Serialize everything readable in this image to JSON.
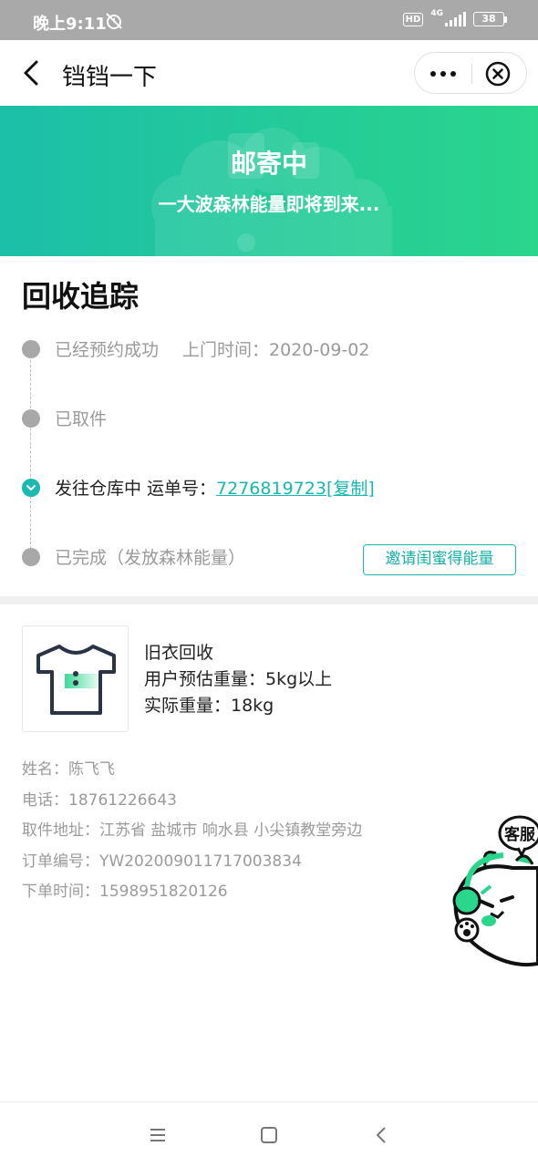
{
  "status_bar": {
    "time": "晚上9:11",
    "hd": "HD",
    "network": "4G",
    "battery": "38"
  },
  "header": {
    "title": "铛铛一下"
  },
  "banner": {
    "title": "邮寄中",
    "subtitle": "一大波森林能量即将到来..."
  },
  "tracking": {
    "section_title": "回收追踪",
    "steps": [
      {
        "text": "已经预约成功",
        "extra": "上门时间：2020-09-02",
        "state": "done"
      },
      {
        "text": "已取件",
        "state": "done"
      },
      {
        "text": "发往仓库中 运单号：",
        "tracking_number": "7276819723",
        "copy_label": "[复制]",
        "state": "active"
      },
      {
        "text": "已完成（发放森林能量）",
        "state": "pending"
      }
    ],
    "invite_button": "邀请闺蜜得能量"
  },
  "product": {
    "name": "旧衣回收",
    "estimated_weight": "用户预估重量：5kg以上",
    "actual_weight": "实际重量：18kg"
  },
  "order": {
    "name": "姓名：陈飞飞",
    "phone": "电话：18761226643",
    "address": "取件地址：江苏省 盐城市 响水县 小尖镇教堂旁边",
    "order_no": "订单编号：YW202009011717003834",
    "order_time": "下单时间：1598951820126"
  },
  "customer_service": {
    "label": "客服"
  },
  "colors": {
    "accent": "#1cb9b0",
    "banner_start": "#1cbfa8",
    "banner_end": "#2ad58c"
  }
}
